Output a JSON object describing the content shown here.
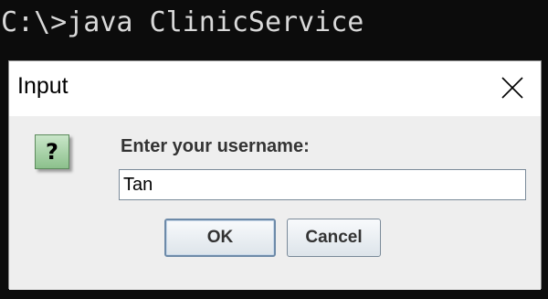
{
  "console": {
    "command_line": "C:\\>java ClinicService"
  },
  "dialog": {
    "title": "Input",
    "close_glyph": "×",
    "icon": "question-icon",
    "icon_glyph": "?",
    "prompt": "Enter your username:",
    "input_value": "Tan",
    "ok_label": "OK",
    "cancel_label": "Cancel"
  },
  "colors": {
    "console_bg": "#0c0c0c",
    "console_text": "#d9d9d9",
    "dialog_content_bg": "#eeeeee",
    "icon_green": "#8cc08c"
  }
}
